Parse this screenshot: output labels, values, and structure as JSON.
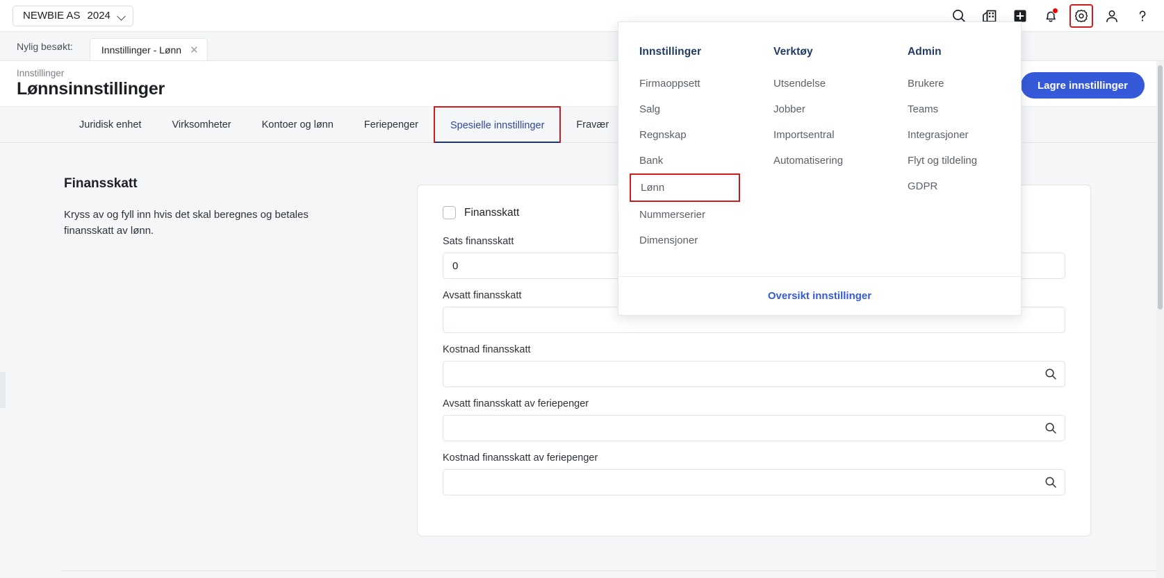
{
  "topbar": {
    "company": "NEWBIE AS",
    "year": "2024",
    "icons": [
      {
        "name": "search-icon",
        "label": "Søk"
      },
      {
        "name": "company-building-icon",
        "label": "Firma"
      },
      {
        "name": "add-plus-icon",
        "label": "Ny"
      },
      {
        "name": "notification-bell-icon",
        "label": "Varsler"
      },
      {
        "name": "gear-settings-icon",
        "label": "Innstillinger"
      },
      {
        "name": "user-profile-icon",
        "label": "Profil"
      },
      {
        "name": "help-question-icon",
        "label": "Hjelp"
      }
    ]
  },
  "recent": {
    "label": "Nylig besøkt:",
    "tab_title": "Innstillinger - Lønn",
    "close_glyph": "✕"
  },
  "page": {
    "breadcrumb": "Innstillinger",
    "title": "Lønnsinnstillinger",
    "save_button": "Lagre innstillinger"
  },
  "tabs": [
    {
      "label": "Juridisk enhet",
      "active": false
    },
    {
      "label": "Virksomheter",
      "active": false
    },
    {
      "label": "Kontoer og lønn",
      "active": false
    },
    {
      "label": "Feriepenger",
      "active": false
    },
    {
      "label": "Spesielle innstillinger",
      "active": true
    },
    {
      "label": "Fravær",
      "active": false
    }
  ],
  "section": {
    "title": "Finansskatt",
    "description": "Kryss av og fyll inn hvis det skal beregnes og betales finansskatt av lønn."
  },
  "form": {
    "checkbox_label": "Finansskatt",
    "checkbox_checked": false,
    "fields": [
      {
        "label": "Sats finansskatt",
        "value": "0",
        "placeholder": "",
        "has_search": false
      },
      {
        "label": "Avsatt finansskatt",
        "value": "",
        "placeholder": "",
        "has_search": false
      },
      {
        "label": "Kostnad finansskatt",
        "value": "",
        "placeholder": "",
        "has_search": true
      },
      {
        "label": "Avsatt finansskatt av feriepenger",
        "value": "",
        "placeholder": "",
        "has_search": true
      },
      {
        "label": "Kostnad finansskatt av feriepenger",
        "value": "",
        "placeholder": "",
        "has_search": true
      }
    ]
  },
  "settings_menu": {
    "columns": [
      {
        "heading": "Innstillinger",
        "items": [
          {
            "label": "Firmaoppsett",
            "highlighted": false
          },
          {
            "label": "Salg",
            "highlighted": false
          },
          {
            "label": "Regnskap",
            "highlighted": false
          },
          {
            "label": "Bank",
            "highlighted": false
          },
          {
            "label": "Lønn",
            "highlighted": true
          },
          {
            "label": "Nummerserier",
            "highlighted": false
          },
          {
            "label": "Dimensjoner",
            "highlighted": false
          }
        ]
      },
      {
        "heading": "Verktøy",
        "items": [
          {
            "label": "Utsendelse",
            "highlighted": false
          },
          {
            "label": "Jobber",
            "highlighted": false
          },
          {
            "label": "Importsentral",
            "highlighted": false
          },
          {
            "label": "Automatisering",
            "highlighted": false
          }
        ]
      },
      {
        "heading": "Admin",
        "items": [
          {
            "label": "Brukere",
            "highlighted": false
          },
          {
            "label": "Teams",
            "highlighted": false
          },
          {
            "label": "Integrasjoner",
            "highlighted": false
          },
          {
            "label": "Flyt og tildeling",
            "highlighted": false
          },
          {
            "label": "GDPR",
            "highlighted": false
          }
        ]
      }
    ],
    "footer_link": "Oversikt innstillinger"
  },
  "colors": {
    "accent_blue": "#3559d8",
    "annotation_red": "#cf1b1b",
    "tab_active": "#2b4a9c",
    "tab_underline": "#1b3668",
    "menu_heading": "#1f3a63",
    "page_bg": "#f4f6f8",
    "notification_dot": "#ee0000"
  }
}
